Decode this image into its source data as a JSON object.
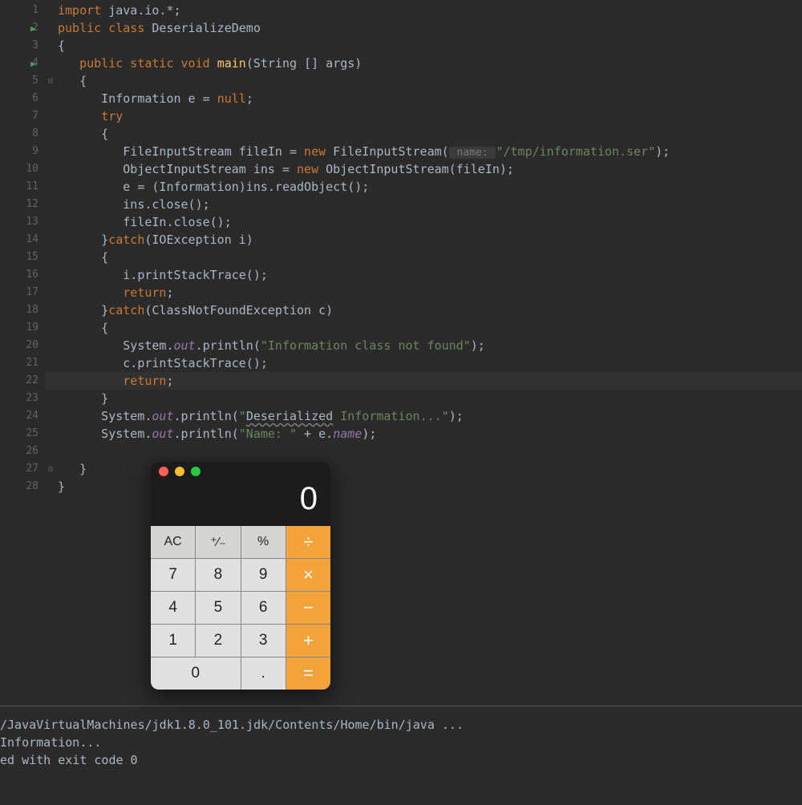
{
  "editor": {
    "highlighted_line_index": 21,
    "lines": [
      {
        "n": 1,
        "run": false,
        "tokens": [
          [
            "kw",
            "import "
          ],
          [
            "cls",
            "java.io.*"
          ],
          [
            "br",
            ";"
          ]
        ]
      },
      {
        "n": 2,
        "run": true,
        "tokens": [
          [
            "kw",
            "public class "
          ],
          [
            "cls",
            "DeserializeDemo"
          ]
        ]
      },
      {
        "n": 3,
        "run": false,
        "tokens": [
          [
            "br",
            "{"
          ]
        ]
      },
      {
        "n": 4,
        "run": true,
        "tokens": [
          [
            "br",
            "   "
          ],
          [
            "kw",
            "public static void "
          ],
          [
            "mth",
            "main"
          ],
          [
            "br",
            "(String "
          ],
          [
            "br",
            "[] "
          ],
          [
            "br",
            "args)"
          ]
        ]
      },
      {
        "n": 5,
        "run": false,
        "fold": "open",
        "tokens": [
          [
            "br",
            "   {"
          ]
        ]
      },
      {
        "n": 6,
        "run": false,
        "tokens": [
          [
            "br",
            "      Information e = "
          ],
          [
            "kw",
            "null"
          ],
          [
            "br",
            ";"
          ]
        ]
      },
      {
        "n": 7,
        "run": false,
        "tokens": [
          [
            "br",
            "      "
          ],
          [
            "kw",
            "try"
          ]
        ]
      },
      {
        "n": 8,
        "run": false,
        "tokens": [
          [
            "br",
            "      {"
          ]
        ]
      },
      {
        "n": 9,
        "run": false,
        "tokens": [
          [
            "br",
            "         FileInputStream fileIn = "
          ],
          [
            "kw",
            "new "
          ],
          [
            "cls",
            "FileInputStream"
          ],
          [
            "br",
            "("
          ],
          [
            "parhint",
            " name: "
          ],
          [
            "str",
            "\"/tmp/information.ser\""
          ],
          [
            "br",
            ");"
          ]
        ]
      },
      {
        "n": 10,
        "run": false,
        "tokens": [
          [
            "br",
            "         ObjectInputStream ins = "
          ],
          [
            "kw",
            "new "
          ],
          [
            "cls",
            "ObjectInputStream"
          ],
          [
            "br",
            "(fileIn);"
          ]
        ]
      },
      {
        "n": 11,
        "run": false,
        "tokens": [
          [
            "br",
            "         e = (Information)ins.readObject();"
          ]
        ]
      },
      {
        "n": 12,
        "run": false,
        "tokens": [
          [
            "br",
            "         ins.close();"
          ]
        ]
      },
      {
        "n": 13,
        "run": false,
        "tokens": [
          [
            "br",
            "         fileIn.close();"
          ]
        ]
      },
      {
        "n": 14,
        "run": false,
        "tokens": [
          [
            "br",
            "      }"
          ],
          [
            "kw",
            "catch"
          ],
          [
            "br",
            "(IOException i)"
          ]
        ]
      },
      {
        "n": 15,
        "run": false,
        "tokens": [
          [
            "br",
            "      {"
          ]
        ]
      },
      {
        "n": 16,
        "run": false,
        "tokens": [
          [
            "br",
            "         i.printStackTrace();"
          ]
        ]
      },
      {
        "n": 17,
        "run": false,
        "tokens": [
          [
            "br",
            "         "
          ],
          [
            "kw",
            "return"
          ],
          [
            "br",
            ";"
          ]
        ]
      },
      {
        "n": 18,
        "run": false,
        "tokens": [
          [
            "br",
            "      }"
          ],
          [
            "kw",
            "catch"
          ],
          [
            "br",
            "(ClassNotFoundException c)"
          ]
        ]
      },
      {
        "n": 19,
        "run": false,
        "tokens": [
          [
            "br",
            "      {"
          ]
        ]
      },
      {
        "n": 20,
        "run": false,
        "tokens": [
          [
            "br",
            "         System."
          ],
          [
            "fld",
            "out"
          ],
          [
            "br",
            ".println("
          ],
          [
            "str",
            "\"Information class not found\""
          ],
          [
            "br",
            ");"
          ]
        ]
      },
      {
        "n": 21,
        "run": false,
        "tokens": [
          [
            "br",
            "         c.printStackTrace();"
          ]
        ]
      },
      {
        "n": 22,
        "run": false,
        "tokens": [
          [
            "br",
            "         "
          ],
          [
            "kw",
            "return"
          ],
          [
            "br",
            ";"
          ]
        ]
      },
      {
        "n": 23,
        "run": false,
        "tokens": [
          [
            "br",
            "      }"
          ]
        ]
      },
      {
        "n": 24,
        "run": false,
        "tokens": [
          [
            "br",
            "      System."
          ],
          [
            "fld",
            "out"
          ],
          [
            "br",
            ".println("
          ],
          [
            "str",
            "\""
          ],
          [
            "und",
            "Deserialized"
          ],
          [
            "str",
            " Information...\""
          ],
          [
            "br",
            ");"
          ]
        ]
      },
      {
        "n": 25,
        "run": false,
        "tokens": [
          [
            "br",
            "      System."
          ],
          [
            "fld",
            "out"
          ],
          [
            "br",
            ".println("
          ],
          [
            "str",
            "\"Name: \""
          ],
          [
            "br",
            " + e."
          ],
          [
            "fld",
            "name"
          ],
          [
            "br",
            ");"
          ]
        ]
      },
      {
        "n": 26,
        "run": false,
        "tokens": [
          [
            "br",
            ""
          ]
        ]
      },
      {
        "n": 27,
        "run": false,
        "fold": "close",
        "tokens": [
          [
            "br",
            "   }"
          ]
        ]
      },
      {
        "n": 28,
        "run": false,
        "tokens": [
          [
            "br",
            "}"
          ]
        ]
      }
    ]
  },
  "tab": {
    "label": "DeserializeDemo"
  },
  "console": {
    "lines": [
      "/JavaVirtualMachines/jdk1.8.0_101.jdk/Contents/Home/bin/java ...",
      "Information...",
      "",
      "ed with exit code 0"
    ]
  },
  "calculator": {
    "display": "0",
    "keys": [
      {
        "label": "AC",
        "class": "fn",
        "name": "clear-button"
      },
      {
        "label": "⁺∕₋",
        "class": "fn",
        "name": "sign-button"
      },
      {
        "label": "%",
        "class": "fn",
        "name": "percent-button"
      },
      {
        "label": "÷",
        "class": "op",
        "name": "divide-button"
      },
      {
        "label": "7",
        "class": "",
        "name": "digit-7-button"
      },
      {
        "label": "8",
        "class": "",
        "name": "digit-8-button"
      },
      {
        "label": "9",
        "class": "",
        "name": "digit-9-button"
      },
      {
        "label": "×",
        "class": "op",
        "name": "multiply-button"
      },
      {
        "label": "4",
        "class": "",
        "name": "digit-4-button"
      },
      {
        "label": "5",
        "class": "",
        "name": "digit-5-button"
      },
      {
        "label": "6",
        "class": "",
        "name": "digit-6-button"
      },
      {
        "label": "−",
        "class": "op",
        "name": "subtract-button"
      },
      {
        "label": "1",
        "class": "",
        "name": "digit-1-button"
      },
      {
        "label": "2",
        "class": "",
        "name": "digit-2-button"
      },
      {
        "label": "3",
        "class": "",
        "name": "digit-3-button"
      },
      {
        "label": "+",
        "class": "op",
        "name": "add-button"
      },
      {
        "label": "0",
        "class": "zero",
        "name": "digit-0-button"
      },
      {
        "label": ".",
        "class": "",
        "name": "decimal-button"
      },
      {
        "label": "=",
        "class": "op",
        "name": "equals-button"
      }
    ]
  }
}
